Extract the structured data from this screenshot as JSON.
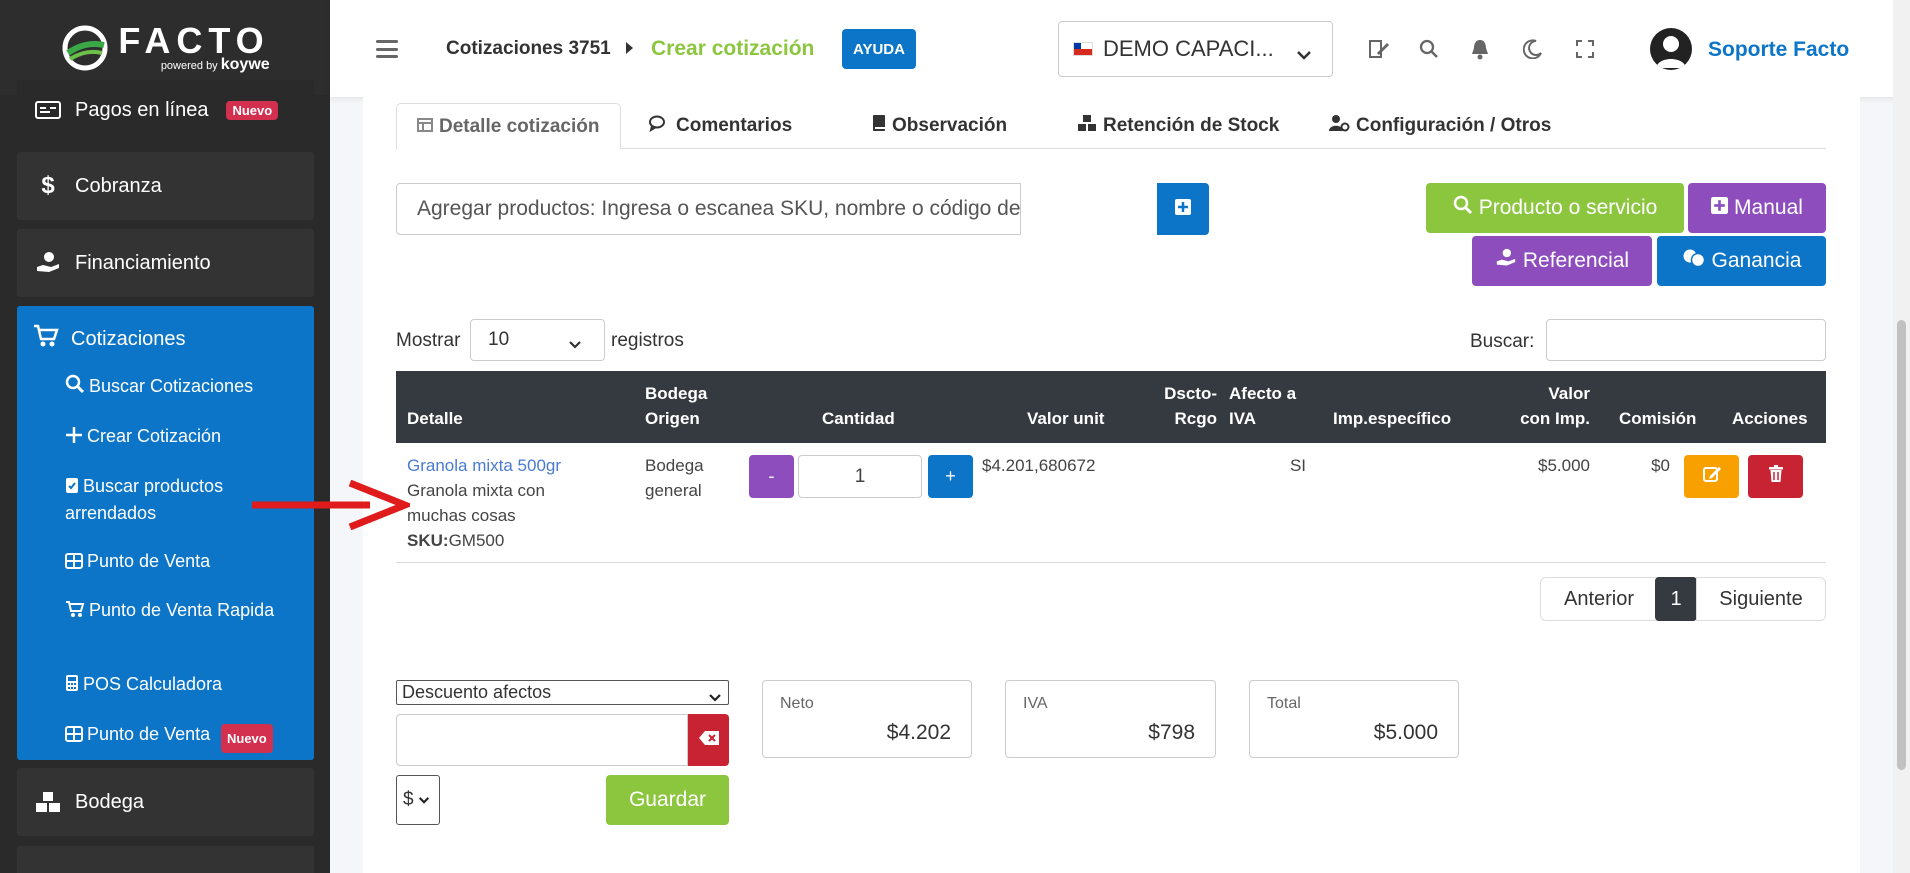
{
  "brand": {
    "logo_text": "FACTO",
    "logo_sub_powered": "powered by",
    "logo_sub_brand": "koywe"
  },
  "sidebar": {
    "items": [
      {
        "label": "Pagos en línea",
        "badge": "Nuevo",
        "icon": "money-bill-icon"
      },
      {
        "label": "Cobranza",
        "icon": "dollar-icon"
      },
      {
        "label": "Financiamiento",
        "icon": "hand-holding-dollar-icon"
      }
    ],
    "open_section": {
      "label": "Cotizaciones",
      "icon": "cart-icon",
      "subitems": [
        {
          "label": "Buscar Cotizaciones",
          "icon": "search-icon"
        },
        {
          "label": "Crear Cotización",
          "icon": "plus-icon"
        },
        {
          "label": "Buscar productos arrendados",
          "icon": "clipboard-check-icon"
        },
        {
          "label": "Punto de Venta",
          "icon": "grid-icon"
        },
        {
          "label": "Punto de Venta Rapida",
          "icon": "cart-icon"
        },
        {
          "label": "POS Calculadora",
          "icon": "calculator-icon"
        },
        {
          "label": "Punto de Venta",
          "badge": "Nuevo",
          "icon": "grid-icon"
        }
      ]
    },
    "after_items": [
      {
        "label": "Bodega",
        "icon": "boxes-icon"
      }
    ]
  },
  "header": {
    "breadcrumb_parent": "Cotizaciones 3751",
    "breadcrumb_current": "Crear cotización",
    "help_label": "AYUDA",
    "company": "DEMO CAPACI...",
    "user_name": "Soporte Facto"
  },
  "tabs": [
    {
      "label": "Detalle cotización",
      "icon": "table-icon",
      "active": true
    },
    {
      "label": "Comentarios",
      "icon": "comments-icon"
    },
    {
      "label": "Observación",
      "icon": "book-icon"
    },
    {
      "label": "Retención de Stock",
      "icon": "cubes-icon"
    },
    {
      "label": "Configuración / Otros",
      "icon": "users-cog-icon"
    }
  ],
  "add_products": {
    "placeholder": "Agregar productos: Ingresa o escanea SKU, nombre o código de barras y"
  },
  "actions": {
    "product_service": "Producto o servicio",
    "manual": "Manual",
    "referencial": "Referencial",
    "ganancia": "Ganancia"
  },
  "table_controls": {
    "show_label": "Mostrar",
    "show_value": "10",
    "records_label": "registros",
    "search_label": "Buscar:"
  },
  "table": {
    "headers": {
      "detalle": "Detalle",
      "bodega_1": "Bodega",
      "bodega_2": "Origen",
      "cantidad": "Cantidad",
      "valor_unit": "Valor unit",
      "dscto_1": "Dscto-",
      "dscto_2": "Rcgo",
      "afecto_1": "Afecto a",
      "afecto_2": "IVA",
      "imp": "Imp.específico",
      "valor_imp_1": "Valor",
      "valor_imp_2": "con Imp.",
      "comision": "Comisión",
      "acciones": "Acciones"
    },
    "rows": [
      {
        "name": "Granola mixta 500gr",
        "desc_1": "Granola mixta con",
        "desc_2": "muchas cosas",
        "sku_label": "SKU:",
        "sku": "GM500",
        "bodega_1": "Bodega",
        "bodega_2": "general",
        "minus": "-",
        "quantity": "1",
        "plus": "+",
        "valor_unit": "$4.201,680672",
        "afecto": "SI",
        "valor_imp": "$5.000",
        "comision": "$0"
      }
    ]
  },
  "pagination": {
    "prev": "Anterior",
    "current": "1",
    "next": "Siguiente"
  },
  "discount": {
    "type": "Descuento afectos",
    "currency": "$",
    "save": "Guardar"
  },
  "totals": {
    "neto_label": "Neto",
    "neto": "$4.202",
    "iva_label": "IVA",
    "iva": "$798",
    "total_label": "Total",
    "total": "$5.000"
  },
  "colors": {
    "sidebar_bg": "#2a2a2a",
    "active_blue": "#0d75c7",
    "green": "#8cc63f",
    "purple": "#8e4dbd",
    "orange": "#f7a000",
    "red": "#c82333"
  }
}
